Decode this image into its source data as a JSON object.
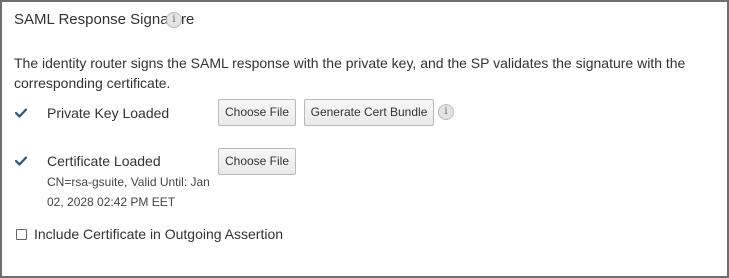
{
  "section": {
    "title": "SAML Response Signature",
    "info_icon": "info-icon",
    "description": "The identity router signs the SAML response with the private key, and the SP validates the signature with the corresponding certificate."
  },
  "private_key": {
    "status_icon": "checkmark-icon",
    "label": "Private Key Loaded",
    "choose_file_label": "Choose File",
    "generate_bundle_label": "Generate Cert Bundle",
    "info_icon": "info-icon"
  },
  "certificate": {
    "status_icon": "checkmark-icon",
    "label": "Certificate Loaded",
    "details": "CN=rsa-gsuite, Valid Until: Jan 02, 2028 02:42 PM EET",
    "choose_file_label": "Choose File"
  },
  "include_certificate": {
    "checked": false,
    "label": "Include Certificate in Outgoing Assertion"
  },
  "colors": {
    "checkmark": "#1f5a8a",
    "border": "#6f6f6f",
    "text": "#333333"
  }
}
